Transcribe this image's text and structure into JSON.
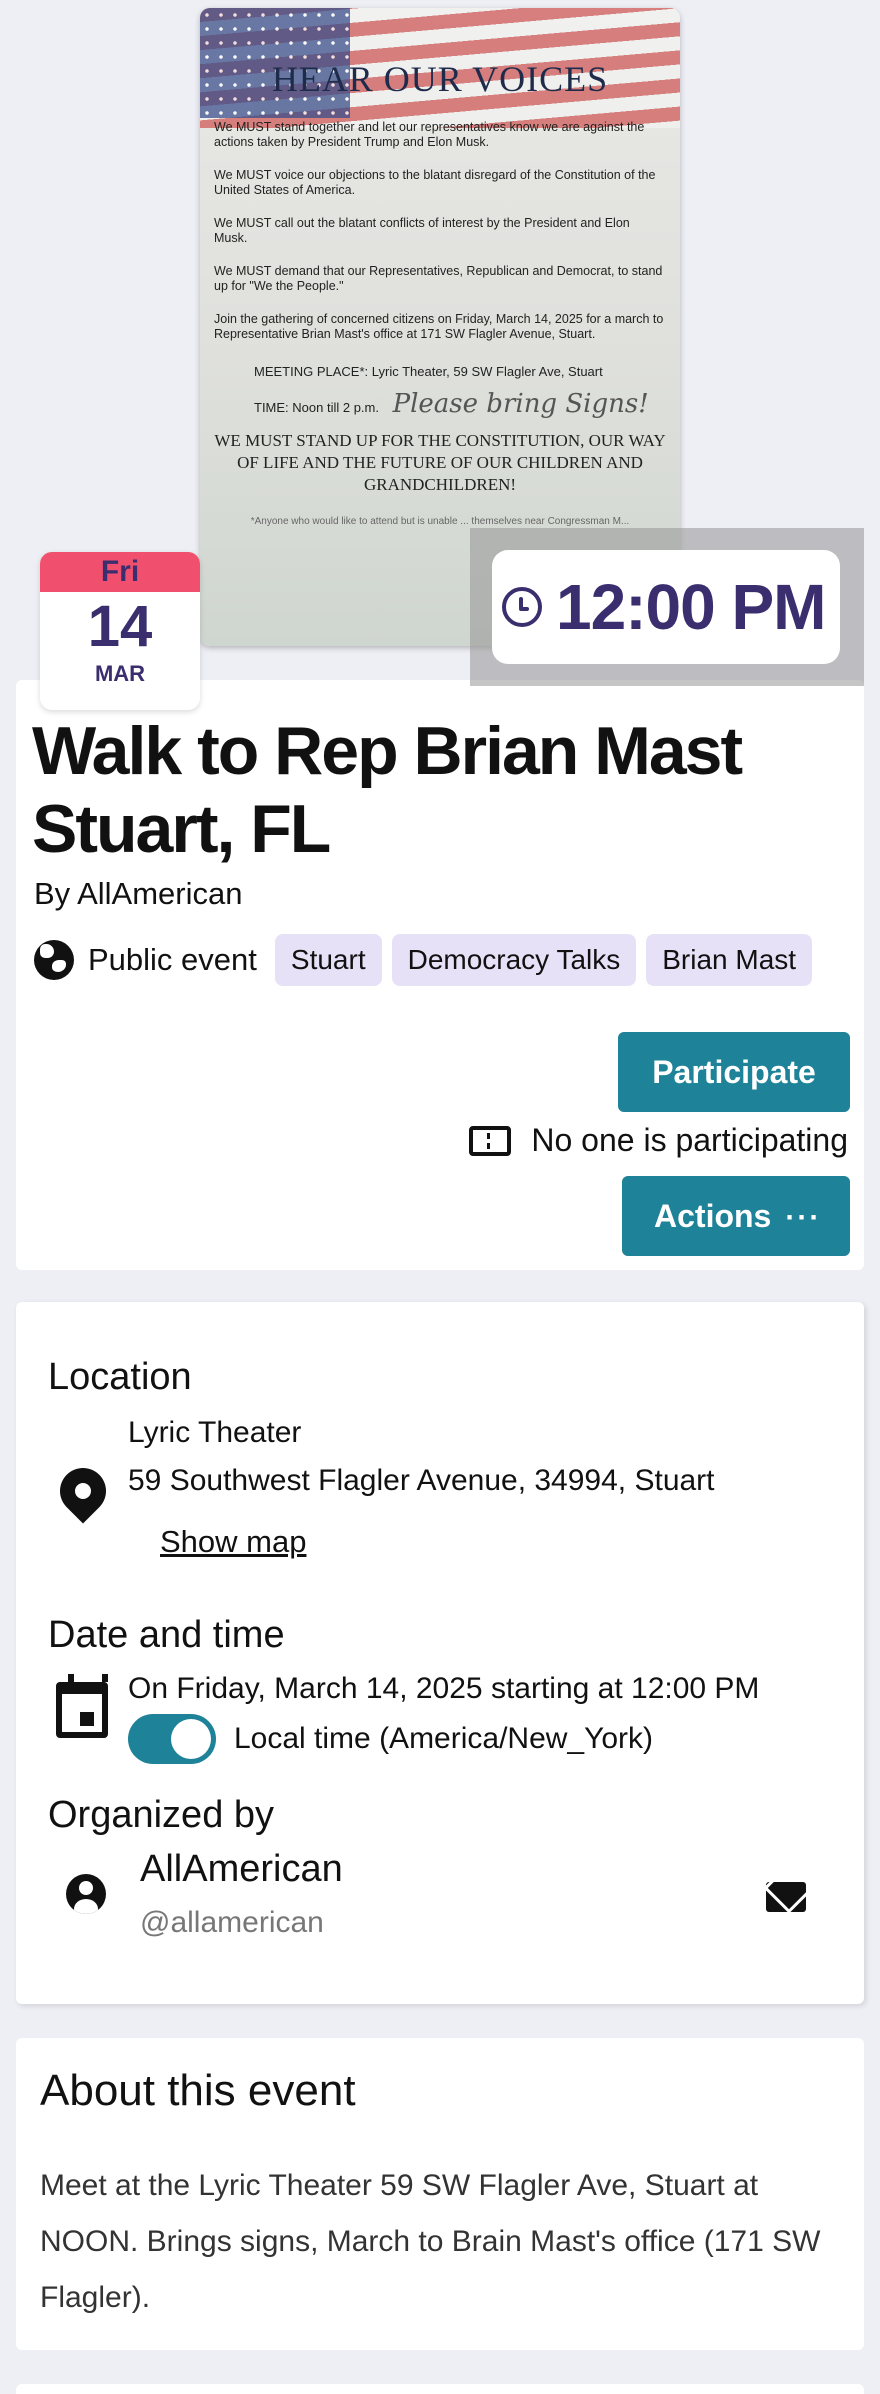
{
  "hero": {
    "flyer_title": "HEAR OUR VOICES",
    "flyer_paragraphs": [
      "We MUST stand together and let our representatives know we are against the actions taken by President Trump and Elon Musk.",
      "We MUST voice our objections to the blatant disregard of the Constitution of the United States of America.",
      "We MUST call out the blatant conflicts of interest by the President and Elon Musk.",
      "We MUST demand that our Representatives, Republican and Democrat, to stand up for \"We the People.\"",
      "Join the gathering of concerned citizens on Friday, March 14, 2025 for a march to Representative Brian Mast's office at 171 SW Flagler Avenue, Stuart."
    ],
    "flyer_meeting": "MEETING PLACE*: Lyric Theater, 59 SW Flagler Ave, Stuart",
    "flyer_time": "TIME: Noon till 2 p.m.",
    "flyer_handwriting": "Please bring Signs!",
    "flyer_must": "WE MUST STAND UP FOR THE CONSTITUTION, OUR WAY OF LIFE AND THE FUTURE OF OUR CHILDREN AND GRANDCHILDREN!",
    "flyer_footnote": "*Anyone who would like to attend but is unable ... themselves near Congressman M..."
  },
  "date_badge": {
    "dow": "Fri",
    "day": "14",
    "month": "MAR"
  },
  "time_badge": {
    "time": "12:00 PM"
  },
  "event": {
    "title": "Walk to Rep Brian Mast Stuart, FL",
    "byline": "By AllAmerican",
    "visibility": "Public event",
    "tags": [
      "Stuart",
      "Democracy Talks",
      "Brian Mast"
    ],
    "participate_label": "Participate",
    "participants_text": "No one is participating",
    "actions_label": "Actions",
    "actions_dots": "···"
  },
  "details": {
    "location_heading": "Location",
    "venue": "Lyric Theater",
    "address": "59 Southwest Flagler Avenue, 34994, Stuart",
    "show_map": "Show map",
    "datetime_heading": "Date and time",
    "datetime_text": "On Friday, March 14, 2025 starting at 12:00 PM",
    "local_time_label": "Local time (America/New_York)",
    "organized_heading": "Organized by",
    "organizer_name": "AllAmerican",
    "organizer_handle": "@allamerican"
  },
  "about": {
    "heading": "About this event",
    "text": "Meet at the Lyric Theater 59 SW Flagler Ave, Stuart at NOON. Brings signs, March to Brain Mast's office (171 SW Flagler)."
  },
  "colors": {
    "accent": "#1e8299",
    "badge_red": "#f0506e",
    "brand_purple": "#3a2e6e",
    "tag_bg": "#e6e1f6"
  },
  "icons": [
    "globe-icon",
    "ticket-icon",
    "pin-icon",
    "calendar-icon",
    "person-icon",
    "mail-icon",
    "clock-icon"
  ]
}
